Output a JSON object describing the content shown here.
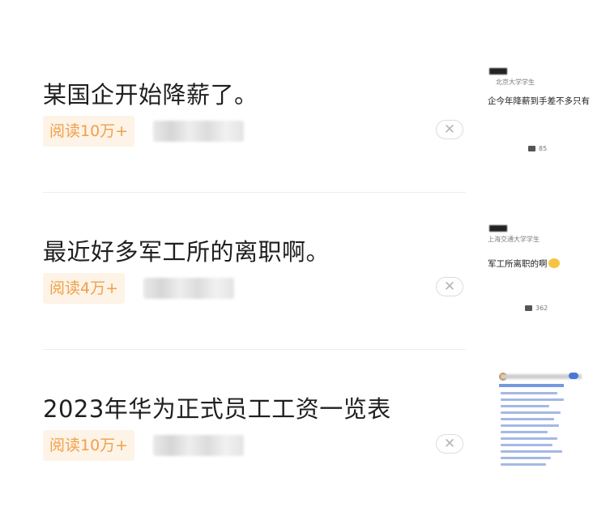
{
  "feed": [
    {
      "title": "某国企开始降薪了。",
      "read_badge": "阅读10万+",
      "close_glyph": "✕",
      "thumbnail": {
        "school": "北京大学学生",
        "snippet": "企今年降薪到手差不多只有去",
        "comment_count": "85"
      }
    },
    {
      "title": "最近好多军工所的离职啊。",
      "read_badge": "阅读4万+",
      "close_glyph": "✕",
      "thumbnail": {
        "school": "上海交通大学学生",
        "snippet": "军工所离职的啊",
        "comment_count": "362"
      }
    },
    {
      "title": "2023年华为正式员工工资一览表",
      "read_badge": "阅读10万+",
      "close_glyph": "✕",
      "thumbnail": {}
    }
  ],
  "icons": {
    "close": "close-icon",
    "comment": "comment-icon"
  },
  "colors": {
    "badge_bg": "#fdf3e6",
    "badge_text": "#f0a04b",
    "title_text": "#1f1f1f",
    "divider": "#eeeeee"
  }
}
